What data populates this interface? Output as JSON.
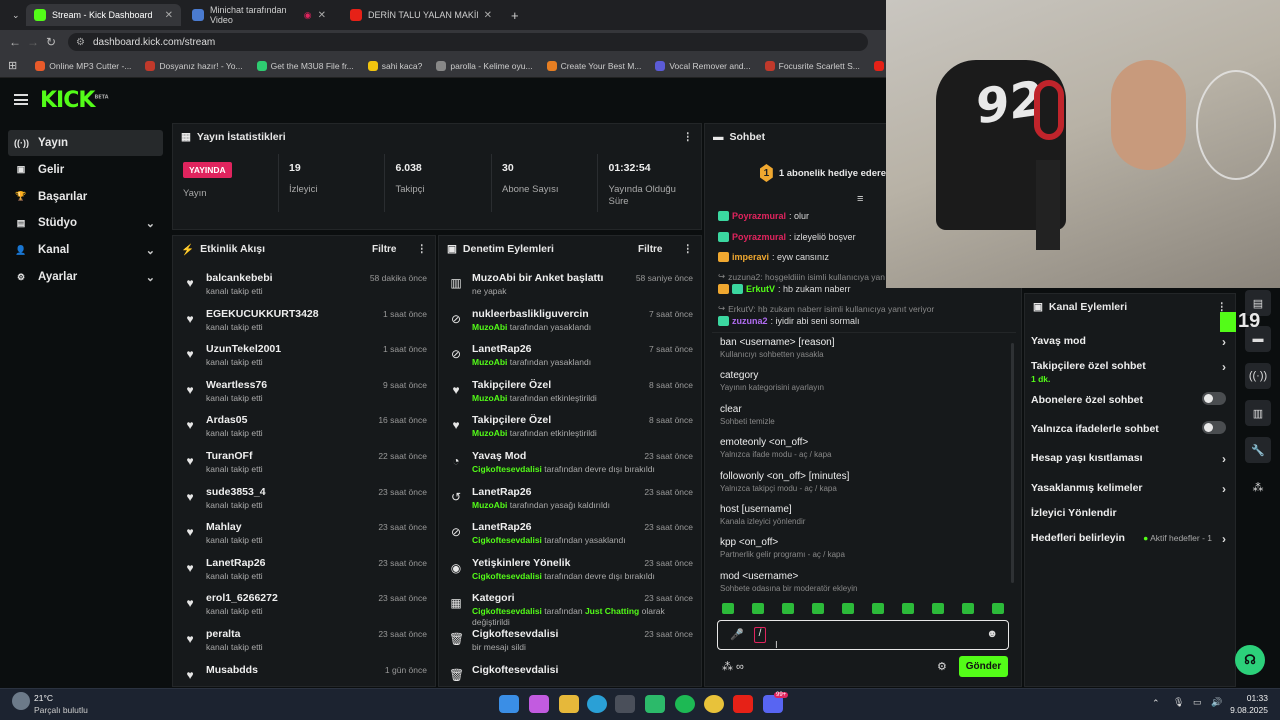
{
  "browser": {
    "tabs": [
      {
        "title": "Stream - Kick Dashboard",
        "color": "#53fc18",
        "active": true
      },
      {
        "title": "Minichat tarafından Video",
        "color": "#4a7bd0",
        "active": false
      },
      {
        "title": "DERİN TALU YALAN MAKİNESİ",
        "color": "#e62117",
        "active": false
      }
    ],
    "new_tab": "+",
    "url": "dashboard.kick.com/stream",
    "bookmarks": [
      {
        "label": "Online MP3 Cutter -...",
        "color": "#e85a2a"
      },
      {
        "label": "Dosyanız hazır! - Yo...",
        "color": "#c0392b"
      },
      {
        "label": "Get the M3U8 File fr...",
        "color": "#2ecc71"
      },
      {
        "label": "sahi kaca?",
        "color": "#f1c40f"
      },
      {
        "label": "parolla - Kelime oyu...",
        "color": "#888888"
      },
      {
        "label": "Create Your Best M...",
        "color": "#e67e22"
      },
      {
        "label": "Vocal Remover and...",
        "color": "#5b5bd6"
      },
      {
        "label": "Focusrite Scarlett S...",
        "color": "#c0392b"
      },
      {
        "label": "Atma - YouTube",
        "color": "#e62117"
      }
    ]
  },
  "brand": {
    "logo": "KICK",
    "beta": "BETA"
  },
  "sidebar": {
    "items": [
      {
        "label": "Yayın",
        "icon": "broadcast-icon",
        "glyph": "((·))",
        "active": true,
        "chevron": false
      },
      {
        "label": "Gelir",
        "icon": "revenue-icon",
        "glyph": "▣",
        "active": false,
        "chevron": false
      },
      {
        "label": "Başarılar",
        "icon": "trophy-icon",
        "glyph": "🏆",
        "active": false,
        "chevron": false
      },
      {
        "label": "Stüdyo",
        "icon": "studio-icon",
        "glyph": "▤",
        "active": false,
        "chevron": true
      },
      {
        "label": "Kanal",
        "icon": "channel-icon",
        "glyph": "👤",
        "active": false,
        "chevron": true
      },
      {
        "label": "Ayarlar",
        "icon": "settings-icon",
        "glyph": "⚙",
        "active": false,
        "chevron": true
      }
    ]
  },
  "stats": {
    "title": "Yayın İstatistikleri",
    "live_badge": "YAYINDA",
    "live_label": "Yayın",
    "items": [
      {
        "value": "19",
        "label": "İzleyici"
      },
      {
        "value": "6.038",
        "label": "Takipçi"
      },
      {
        "value": "30",
        "label": "Abone Sayısı"
      },
      {
        "value": "01:32:54",
        "label": "Yayında Olduğu Süre"
      }
    ]
  },
  "activity": {
    "title": "Etkinlik Akışı",
    "filter": "Filtre",
    "rows": [
      {
        "name": "balcankebebi",
        "sub": "kanalı takip etti",
        "time": "58 dakika önce"
      },
      {
        "name": "EGEKUCUKKURT3428",
        "sub": "kanalı takip etti",
        "time": "1 saat önce"
      },
      {
        "name": "UzunTekel2001",
        "sub": "kanalı takip etti",
        "time": "1 saat önce"
      },
      {
        "name": "Weartless76",
        "sub": "kanalı takip etti",
        "time": "9 saat önce"
      },
      {
        "name": "Ardas05",
        "sub": "kanalı takip etti",
        "time": "16 saat önce"
      },
      {
        "name": "TuranOFf",
        "sub": "kanalı takip etti",
        "time": "22 saat önce"
      },
      {
        "name": "sude3853_4",
        "sub": "kanalı takip etti",
        "time": "23 saat önce"
      },
      {
        "name": "Mahlay",
        "sub": "kanalı takip etti",
        "time": "23 saat önce"
      },
      {
        "name": "LanetRap26",
        "sub": "kanalı takip etti",
        "time": "23 saat önce"
      },
      {
        "name": "erol1_6266272",
        "sub": "kanalı takip etti",
        "time": "23 saat önce"
      },
      {
        "name": "peralta",
        "sub": "kanalı takip etti",
        "time": "23 saat önce"
      },
      {
        "name": "Musabdds",
        "sub": "",
        "time": "1 gün önce"
      }
    ]
  },
  "moderation": {
    "title": "Denetim Eylemleri",
    "filter": "Filtre",
    "rows": [
      {
        "icon": "poll-icon",
        "glyph": "▥",
        "name": "MuzoAbi bir Anket başlattı",
        "actor": "",
        "action": "ne yapak",
        "time": "58 saniye önce"
      },
      {
        "icon": "ban-icon",
        "glyph": "⊘",
        "name": "nukleerbaslikliguvercin",
        "actor": "MuzoAbi",
        "action": " tarafından yasaklandı",
        "time": "7 saat önce"
      },
      {
        "icon": "ban-icon",
        "glyph": "⊘",
        "name": "LanetRap26",
        "actor": "MuzoAbi",
        "action": " tarafından yasaklandı",
        "time": "7 saat önce"
      },
      {
        "icon": "heart-icon",
        "glyph": "♥",
        "name": "Takipçilere Özel",
        "actor": "MuzoAbi",
        "action": " tarafından etkinleştirildi",
        "time": "8 saat önce"
      },
      {
        "icon": "heart-icon",
        "glyph": "♥",
        "name": "Takipçilere Özel",
        "actor": "MuzoAbi",
        "action": " tarafından etkinleştirildi",
        "time": "8 saat önce"
      },
      {
        "icon": "slow-mode-icon",
        "glyph": "◔",
        "name": "Yavaş Mod",
        "actor": "Cigkoftesevdalisi",
        "action": " tarafından devre dışı bırakıldı",
        "time": "23 saat önce"
      },
      {
        "icon": "unban-icon",
        "glyph": "↺",
        "name": "LanetRap26",
        "actor": "MuzoAbi",
        "action": " tarafından yasağı kaldırıldı",
        "time": "23 saat önce"
      },
      {
        "icon": "ban-icon",
        "glyph": "⊘",
        "name": "LanetRap26",
        "actor": "Cigkoftesevdalisi",
        "action": " tarafından yasaklandı",
        "time": "23 saat önce"
      },
      {
        "icon": "eye-icon",
        "glyph": "◉",
        "name": "Yetişkinlere Yönelik",
        "actor": "Cigkoftesevdalisi",
        "action": " tarafından devre dışı bırakıldı",
        "time": "23 saat önce"
      },
      {
        "icon": "category-icon",
        "glyph": "▦",
        "name": "Kategori",
        "actor": "Cigkoftesevdalisi",
        "action": " tarafından ",
        "extra": "Just Chatting",
        "action2": " olarak",
        "line2": "değiştirildi",
        "time": "23 saat önce"
      },
      {
        "icon": "trash-icon",
        "glyph": "🗑",
        "name": "Cigkoftesevdalisi",
        "actor": "",
        "action": "bir mesajı sildi",
        "time": "23 saat önce"
      },
      {
        "icon": "trash-icon",
        "glyph": "🗑",
        "name": "Cigkoftesevdalisi",
        "actor": "",
        "action": "",
        "time": ""
      }
    ]
  },
  "chat": {
    "title": "Sohbet",
    "gift_count": "1",
    "gift_text": "1 abonelik hediye edere",
    "messages": [
      {
        "user": "Poyrazmural",
        "color": "#e0245e",
        "text": ": olur"
      },
      {
        "user": "Poyrazmural",
        "color": "#e0245e",
        "text": ": izleyeliö boşver"
      },
      {
        "user": "imperavi",
        "color": "#f0a830",
        "text": ": eyw cansınız"
      }
    ],
    "reply1": "zuzuna2: hoşgeldiiin isimli kullanıcıya yan",
    "msg_erkut": {
      "user": "ErkutV",
      "color": "#53fc18",
      "text": ": hb zukam naberr"
    },
    "reply2": "ErkutV: hb zukam naberr isimli kullanıcıya yanıt veriyor",
    "msg_zuzuna": {
      "user": "zuzuna2",
      "color": "#b06cf0",
      "text": ": iyidir abi seni sormalı"
    },
    "commands": [
      {
        "cmd": "ban <username> [reason]",
        "desc": "Kullanıcıyı sohbetten yasakla"
      },
      {
        "cmd": "category",
        "desc": "Yayının kategorisini ayarlayın"
      },
      {
        "cmd": "clear",
        "desc": "Sohbeti temizle"
      },
      {
        "cmd": "emoteonly <on_off>",
        "desc": "Yalnızca ifade modu - aç / kapa"
      },
      {
        "cmd": "followonly <on_off> [minutes]",
        "desc": "Yalnızca takipçi modu - aç / kapa"
      },
      {
        "cmd": "host [username]",
        "desc": "Kanala izleyici yönlendir"
      },
      {
        "cmd": "kpp <on_off>",
        "desc": "Partnerlik gelir programı - aç / kapa"
      },
      {
        "cmd": "mod <username>",
        "desc": "Sohbete odasına bir moderatör ekleyin"
      }
    ],
    "input_value": "/",
    "send": "Gönder"
  },
  "channel_actions": {
    "title": "Kanal Eylemleri",
    "items": [
      {
        "label": "Yavaş mod",
        "kind": "arrow"
      },
      {
        "label": "Takipçilere özel sohbet",
        "sub": "1 dk.",
        "kind": "arrow"
      },
      {
        "label": "Abonelere özel sohbet",
        "kind": "toggle"
      },
      {
        "label": "Yalnızca ifadelerle sohbet",
        "kind": "toggle"
      },
      {
        "label": "Hesap yaşı kısıtlaması",
        "kind": "arrow"
      },
      {
        "label": "Yasaklanmış kelimeler",
        "kind": "arrow"
      },
      {
        "label": "İzleyici Yönlendir",
        "kind": "none"
      },
      {
        "label": "Hedefleri belirleyin",
        "kind": "goal",
        "goal": "Aktif hedefler - 1"
      }
    ]
  },
  "overlay": {
    "viewer_count": "19"
  },
  "taskbar": {
    "weather_temp": "21°C",
    "weather_desc": "Parçalı bulutlu",
    "time": "01:33",
    "date": "9.08.2025",
    "discord_badge": "99+"
  }
}
